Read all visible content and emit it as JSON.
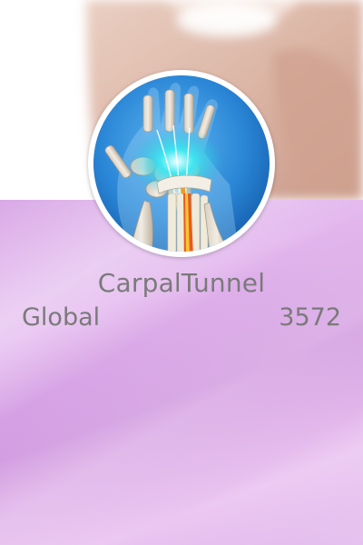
{
  "profile": {
    "username": "CarpalTunnel",
    "region": "Global",
    "score": "3572"
  },
  "icons": {
    "banner": "hand-photo",
    "avatar": "wrist-bones-avatar-icon"
  },
  "colors": {
    "panel_gradient_start": "#d9a9e6",
    "panel_gradient_mid": "#cf94de",
    "panel_gradient_end": "#ebc7f1",
    "text": "#7a7a7a",
    "avatar_blue": "#1a6fc4",
    "avatar_glow": "#28d8e8"
  }
}
